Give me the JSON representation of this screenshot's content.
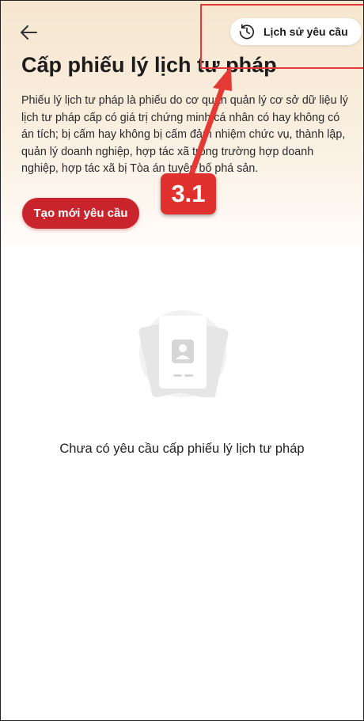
{
  "header": {
    "back_icon": "arrow-left-icon",
    "history_icon": "clock-history-icon",
    "history_label": "Lịch sử yêu cầu"
  },
  "main": {
    "title": "Cấp phiếu lý lịch tư pháp",
    "description": "Phiếu lý lịch tư pháp là phiếu do cơ quan quản lý cơ sở dữ liệu lý lịch tư pháp cấp có giá trị chứng minh cá nhân có hay không có án tích; bị cấm hay không bị cấm đảm nhiệm chức vụ, thành lập, quản lý doanh nghiệp, hợp tác xã trong trường hợp doanh nghiệp, hợp tác xã bị Tòa án tuyên bố phá sản.",
    "create_button_label": "Tạo mới yêu cầu"
  },
  "annotation": {
    "step_label": "3.1",
    "color": "#e53935"
  },
  "empty_state": {
    "icon": "id-card-placeholder-icon",
    "message": "Chưa có yêu cầu cấp phiếu lý lịch tư pháp"
  },
  "colors": {
    "primary": "#c9242b",
    "hero_bg": "#f6e6cf"
  }
}
